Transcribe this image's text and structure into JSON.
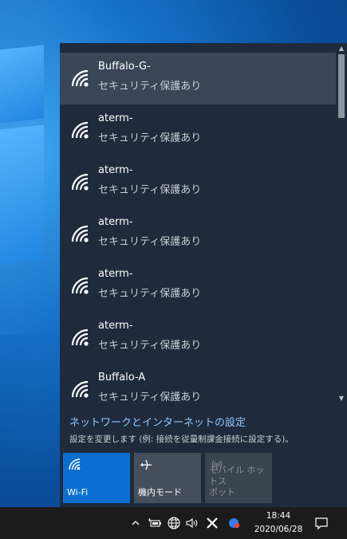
{
  "networks": [
    {
      "name": "Buffalo-G-",
      "status": "セキュリティ保護あり",
      "selected": true
    },
    {
      "name": "aterm-",
      "status": "セキュリティ保護あり"
    },
    {
      "name": "aterm-",
      "status": "セキュリティ保護あり"
    },
    {
      "name": "aterm-",
      "status": "セキュリティ保護あり"
    },
    {
      "name": "aterm-",
      "status": "セキュリティ保護あり"
    },
    {
      "name": "aterm-",
      "status": "セキュリティ保護あり"
    },
    {
      "name": "Buffalo-A",
      "status": "セキュリティ保護あり"
    }
  ],
  "settings": {
    "link": "ネットワークとインターネットの設定",
    "description": "設定を変更します (例: 接続を従量制課金接続に設定する)。"
  },
  "tiles": {
    "wifi": {
      "label": "Wi-Fi",
      "icon": "wifi-icon",
      "color": "#0a6fd1"
    },
    "airplane": {
      "label": "機内モード",
      "icon": "airplane-icon"
    },
    "hotspot": {
      "label_line1": "モバイル ホットス",
      "label_line2": "ポット",
      "icon": "hotspot-icon"
    }
  },
  "taskbar": {
    "time": "18:44",
    "date": "2020/06/28",
    "icons": [
      "chevron-up-icon",
      "battery-plug-icon",
      "network-globe-icon",
      "volume-icon",
      "x-app-icon",
      "chrome-like-app-icon",
      "notification-icon"
    ]
  },
  "colors": {
    "flyout_bg": "#1f2b3c",
    "selected_bg": "#3a4658",
    "link": "#8fc9ff",
    "taskbar_bg": "#1b1b1c"
  }
}
